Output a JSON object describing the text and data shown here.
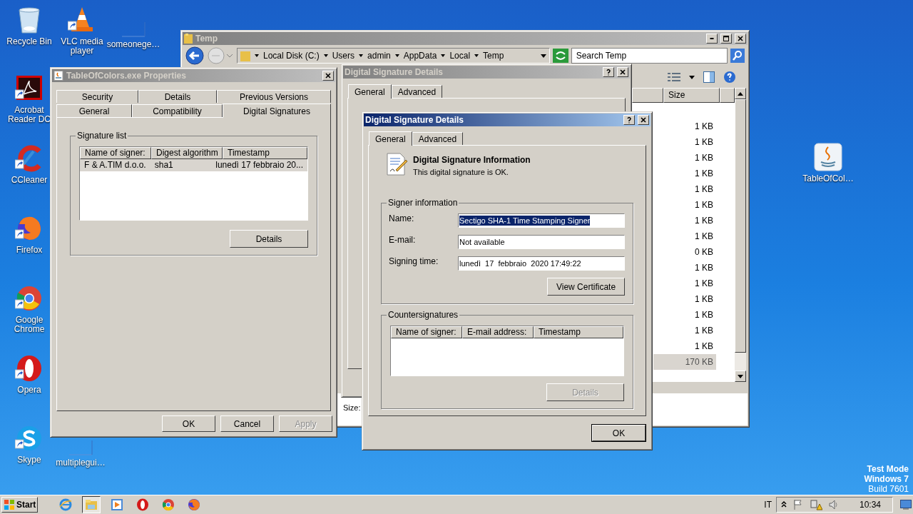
{
  "desktop_icons": [
    {
      "label": "Recycle Bin",
      "kind": "recycle"
    },
    {
      "label": "VLC media player",
      "kind": "vlc"
    },
    {
      "label": "someonege…",
      "kind": "blank"
    },
    {
      "label": "Acrobat Reader DC",
      "kind": "acrobat"
    },
    {
      "label": "CCleaner",
      "kind": "ccleaner"
    },
    {
      "label": "Firefox",
      "kind": "firefox"
    },
    {
      "label": "Google Chrome",
      "kind": "chrome"
    },
    {
      "label": "Opera",
      "kind": "opera"
    },
    {
      "label": "Skype",
      "kind": "skype"
    },
    {
      "label": "multiplegui…",
      "kind": "blank"
    },
    {
      "label": "TableOfCol…",
      "kind": "java"
    }
  ],
  "explorer": {
    "title": "Temp",
    "breadcrumbs": [
      "Local Disk (C:)",
      "Users",
      "admin",
      "AppData",
      "Local",
      "Temp"
    ],
    "search": {
      "placeholder": "Search Temp"
    },
    "columns": [
      "Size"
    ],
    "rows": [
      {
        "size": "",
        "selected": false
      },
      {
        "size": "1 KB",
        "selected": false
      },
      {
        "size": "1 KB",
        "selected": false
      },
      {
        "size": "1 KB",
        "selected": false
      },
      {
        "size": "1 KB",
        "selected": false
      },
      {
        "size": "1 KB",
        "selected": false
      },
      {
        "size": "1 KB",
        "selected": false
      },
      {
        "size": "1 KB",
        "selected": false
      },
      {
        "size": "1 KB",
        "selected": false
      },
      {
        "size": "0 KB",
        "selected": false
      },
      {
        "size": "1 KB",
        "selected": false
      },
      {
        "size": "1 KB",
        "selected": false
      },
      {
        "size": "1 KB",
        "selected": false
      },
      {
        "size": "1 KB",
        "selected": false
      },
      {
        "size": "1 KB",
        "selected": false
      },
      {
        "size": "1 KB",
        "selected": false
      },
      {
        "size": "170 KB",
        "selected": true
      }
    ],
    "status": "Size:"
  },
  "properties": {
    "title": "TableOfColors.exe Properties",
    "tab_rows": [
      [
        {
          "label": "Security",
          "selected": false
        },
        {
          "label": "Details",
          "selected": false
        },
        {
          "label": "Previous Versions",
          "selected": false
        }
      ],
      [
        {
          "label": "General",
          "selected": false
        },
        {
          "label": "Compatibility",
          "selected": false
        },
        {
          "label": "Digital Signatures",
          "selected": true
        }
      ]
    ],
    "group": "Signature list",
    "columns": [
      "Name of signer:",
      "Digest algorithm",
      "Timestamp"
    ],
    "rows": [
      {
        "cells": [
          "F & A.TIM d.o.o.",
          "sha1",
          "lunedì 17 febbraio 20..."
        ],
        "selected": true
      }
    ],
    "details_button": "Details",
    "buttons": [
      {
        "label": "OK",
        "disabled": false
      },
      {
        "label": "Cancel",
        "disabled": false
      },
      {
        "label": "Apply",
        "disabled": true
      }
    ]
  },
  "back_dialog": {
    "title": "Digital Signature Details",
    "tabs": [
      {
        "label": "General",
        "selected": true
      },
      {
        "label": "Advanced",
        "selected": false
      }
    ]
  },
  "front_dialog": {
    "title": "Digital Signature Details",
    "tabs": [
      {
        "label": "General",
        "selected": true
      },
      {
        "label": "Advanced",
        "selected": false
      }
    ],
    "heading": "Digital Signature Information",
    "message": "This digital signature is OK.",
    "signer_group": "Signer information",
    "fields": [
      {
        "label": "Name:",
        "value": "Sectigo SHA-1 Time Stamping Signer",
        "selected": true
      },
      {
        "label": "E-mail:",
        "value": "Not available",
        "selected": false
      },
      {
        "label": "Signing time:",
        "value": "lunedì  17  febbraio  2020 17:49:22",
        "selected": false
      }
    ],
    "view_certificate": "View Certificate",
    "counter_group": "Countersignatures",
    "counter_columns": [
      "Name of signer:",
      "E-mail address:",
      "Timestamp"
    ],
    "details_button": {
      "label": "Details",
      "disabled": true
    },
    "ok": "OK"
  },
  "test_mode": [
    "Test Mode",
    "Windows 7",
    "Build 7601"
  ],
  "taskbar": {
    "start": "Start",
    "apps": [
      {
        "kind": "ie",
        "selected": false
      },
      {
        "kind": "folder",
        "selected": true
      },
      {
        "kind": "media",
        "selected": false
      },
      {
        "kind": "opera",
        "selected": false
      },
      {
        "kind": "chrome",
        "selected": false
      },
      {
        "kind": "firefox",
        "selected": false
      }
    ],
    "language": "IT",
    "clock": "10:34"
  }
}
